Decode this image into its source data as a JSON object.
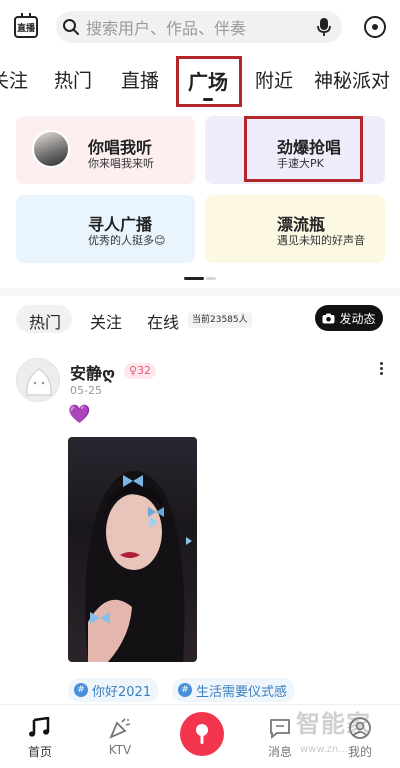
{
  "header": {
    "live_icon_label": "直播",
    "search_placeholder": "搜索用户、作品、伴奏",
    "icons": [
      "live-icon",
      "search-icon",
      "mic-icon",
      "more-icon"
    ]
  },
  "tabs": [
    {
      "label": "关注"
    },
    {
      "label": "热门"
    },
    {
      "label": "直播"
    },
    {
      "label": "广场",
      "active": true
    },
    {
      "label": "附近"
    },
    {
      "label": "神秘派对"
    }
  ],
  "cards": [
    {
      "title": "你唱我听",
      "subtitle": "你来唱我来听"
    },
    {
      "title": "劲爆抢唱",
      "subtitle": "手速大PK"
    },
    {
      "title": "寻人广播",
      "subtitle": "优秀的人挺多😊"
    },
    {
      "title": "漂流瓶",
      "subtitle": "遇见未知的好声音"
    }
  ],
  "filters": {
    "items": [
      "热门",
      "关注",
      "在线"
    ],
    "active": "热门",
    "online_count": "当前23585人",
    "post_button": "发动态"
  },
  "post": {
    "username": "安静ღ",
    "gender_symbol": "♀",
    "age": "32",
    "date": "05-25",
    "content_emoji": "💜",
    "tags": [
      "你好2021",
      "生活需要仪式感"
    ]
  },
  "bottom_nav": [
    {
      "label": "首页",
      "icon": "music-note-icon"
    },
    {
      "label": "KTV",
      "icon": "party-popper-icon"
    },
    {
      "label": "",
      "icon": "record-mic-icon"
    },
    {
      "label": "消息",
      "icon": "message-icon"
    },
    {
      "label": "我的",
      "icon": "profile-icon"
    }
  ],
  "watermark": {
    "text": "智能家",
    "url": "www.zn..."
  },
  "colors": {
    "accent_red": "#f2344c",
    "annotation_red": "#b3262a",
    "card_pink": "#fdeef0",
    "card_lavender": "#f1ecfb",
    "card_blue": "#eaf4fc",
    "card_yellow": "#fdf8e4",
    "tag_blue": "#3c7fbf"
  }
}
